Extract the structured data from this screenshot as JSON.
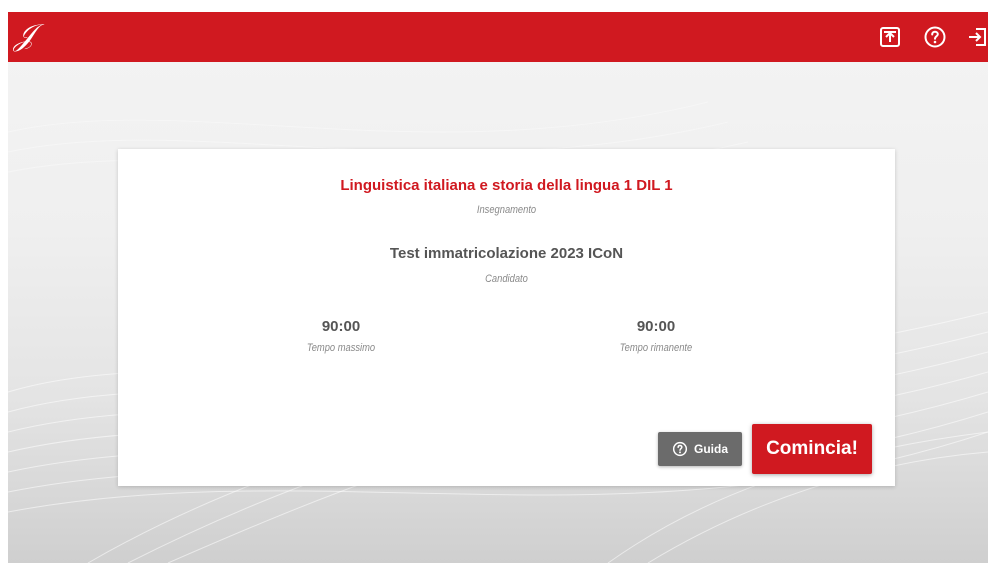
{
  "header": {
    "logo_text": "𝒥",
    "icons": [
      "upload-icon",
      "help-icon",
      "logout-icon"
    ],
    "background": "#d01920"
  },
  "exam": {
    "course_title": "Linguistica italiana e storia della lingua 1 DIL 1",
    "course_caption": "Insegnamento",
    "candidate_name": "Test immatricolazione 2023 ICoN",
    "candidate_caption": "Candidato",
    "max_time": "90:00",
    "max_time_caption": "Tempo massimo",
    "remaining_time": "90:00",
    "remaining_time_caption": "Tempo rimanente"
  },
  "actions": {
    "guide_label": "Guida",
    "start_label": "Comincia!"
  },
  "colors": {
    "accent": "#d01920",
    "secondary_button": "#6b6b6b",
    "text_dark": "#555555",
    "caption": "#8a8a8a"
  }
}
